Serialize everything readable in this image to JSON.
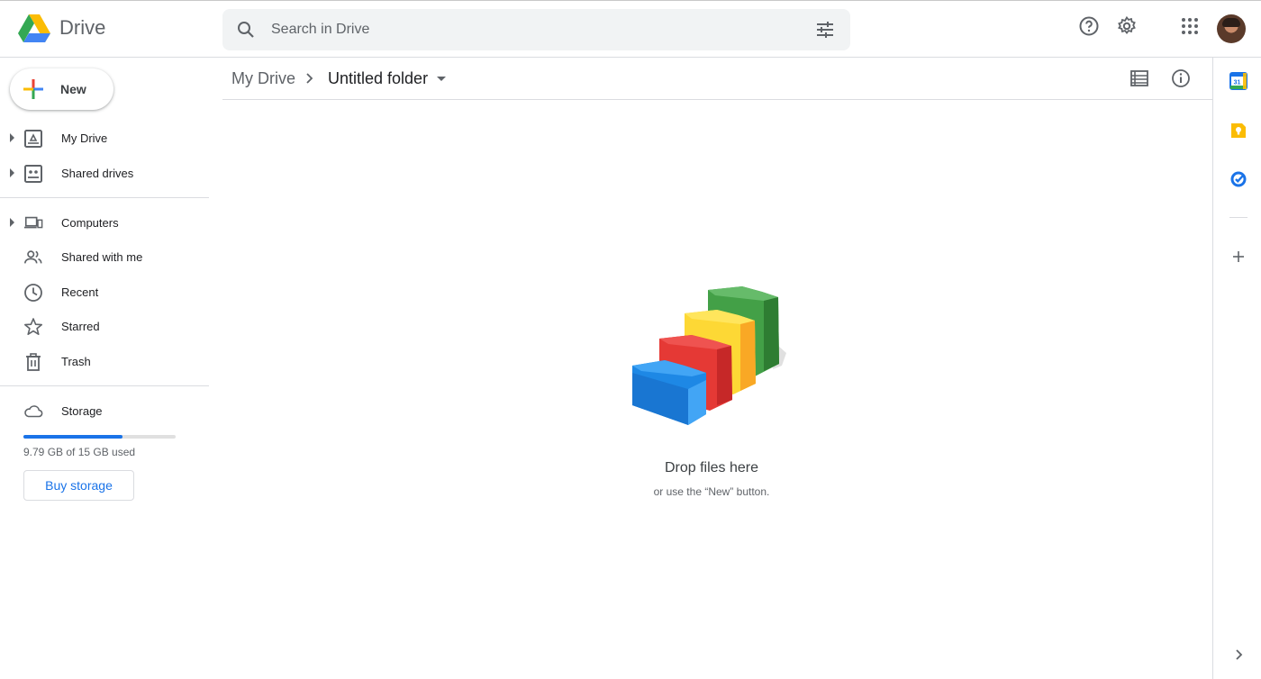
{
  "app": {
    "name": "Drive"
  },
  "search": {
    "placeholder": "Search in Drive",
    "value": ""
  },
  "header": {
    "icons": [
      "search-icon",
      "tune-icon",
      "help-icon",
      "settings-icon",
      "apps-grid-icon",
      "avatar"
    ]
  },
  "sidebar": {
    "new_label": "New",
    "items": [
      {
        "label": "My Drive",
        "icon": "my-drive-icon",
        "expandable": true
      },
      {
        "label": "Shared drives",
        "icon": "shared-drives-icon",
        "expandable": true
      },
      {
        "label": "Computers",
        "icon": "computers-icon",
        "expandable": true
      },
      {
        "label": "Shared with me",
        "icon": "shared-with-me-icon",
        "expandable": false
      },
      {
        "label": "Recent",
        "icon": "clock-icon",
        "expandable": false
      },
      {
        "label": "Starred",
        "icon": "star-icon",
        "expandable": false
      },
      {
        "label": "Trash",
        "icon": "trash-icon",
        "expandable": false
      }
    ],
    "storage": {
      "label": "Storage",
      "used_text": "9.79 GB of 15 GB used",
      "used_fraction": 0.65,
      "buy_label": "Buy storage"
    }
  },
  "breadcrumb": {
    "root": "My Drive",
    "current": "Untitled folder"
  },
  "empty_state": {
    "title": "Drop files here",
    "subtitle": "or use the “New” button."
  },
  "right_rail": {
    "calendar_day": "31",
    "icons": [
      "calendar-icon",
      "keep-icon",
      "tasks-icon",
      "add-icon",
      "chevron-right-icon"
    ]
  },
  "colors": {
    "blue": "#1a73e8",
    "green": "#34a853",
    "yellow": "#fbbc04",
    "red": "#ea4335"
  }
}
